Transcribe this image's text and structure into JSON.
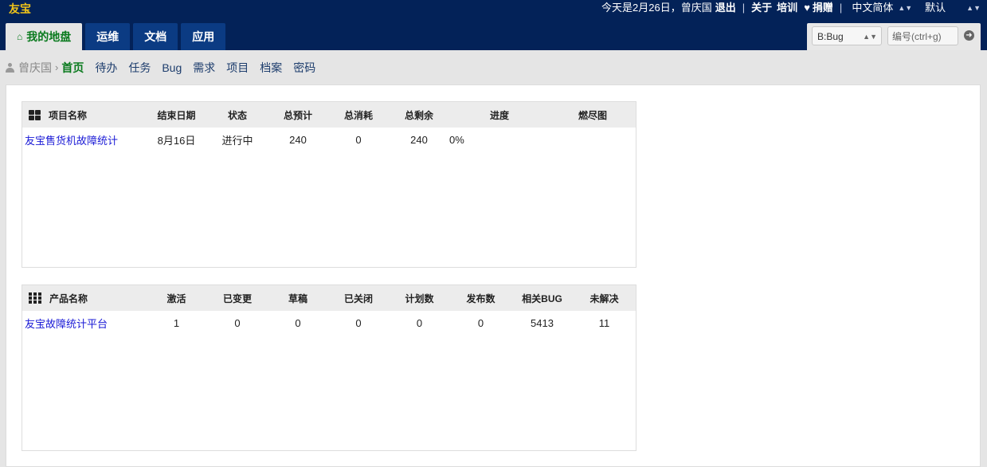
{
  "brand": "友宝",
  "topbar": {
    "greeting": "今天是2月26日，曾庆国",
    "logout": "退出",
    "separator": "|",
    "about": "关于",
    "training": "培训",
    "donate": "捐赠",
    "language": "中文简体",
    "theme": "默认"
  },
  "main_nav": {
    "tabs": [
      {
        "label": "我的地盘",
        "active": true
      },
      {
        "label": "运维"
      },
      {
        "label": "文档"
      },
      {
        "label": "应用"
      }
    ]
  },
  "search": {
    "type_selected": "B:Bug",
    "placeholder": "编号(ctrl+g)"
  },
  "sub_nav": {
    "user": "曾庆国",
    "items": [
      {
        "label": "首页",
        "active": true
      },
      {
        "label": "待办"
      },
      {
        "label": "任务"
      },
      {
        "label": "Bug"
      },
      {
        "label": "需求"
      },
      {
        "label": "项目"
      },
      {
        "label": "档案"
      },
      {
        "label": "密码"
      }
    ]
  },
  "project_table": {
    "headers": [
      "项目名称",
      "结束日期",
      "状态",
      "总预计",
      "总消耗",
      "总剩余",
      "进度",
      "燃尽图"
    ],
    "rows": [
      {
        "name": "友宝售货机故障统计",
        "end": "8月16日",
        "status": "进行中",
        "estimate": "240",
        "consumed": "0",
        "left": "240",
        "progress": "0%",
        "burn": ""
      }
    ]
  },
  "product_table": {
    "headers": [
      "产品名称",
      "激活",
      "已变更",
      "草稿",
      "已关闭",
      "计划数",
      "发布数",
      "相关BUG",
      "未解决"
    ],
    "rows": [
      {
        "name": "友宝故障统计平台",
        "active": "1",
        "changed": "0",
        "draft": "0",
        "closed": "0",
        "plans": "0",
        "releases": "0",
        "bugs": "5413",
        "unresolved": "11"
      }
    ]
  },
  "colors": {
    "topbar": "#032258",
    "brand": "#f0c419",
    "nav_tab": "#0b3b83",
    "active_green": "#0a7a1e",
    "link_blue": "#1a1ad6"
  }
}
